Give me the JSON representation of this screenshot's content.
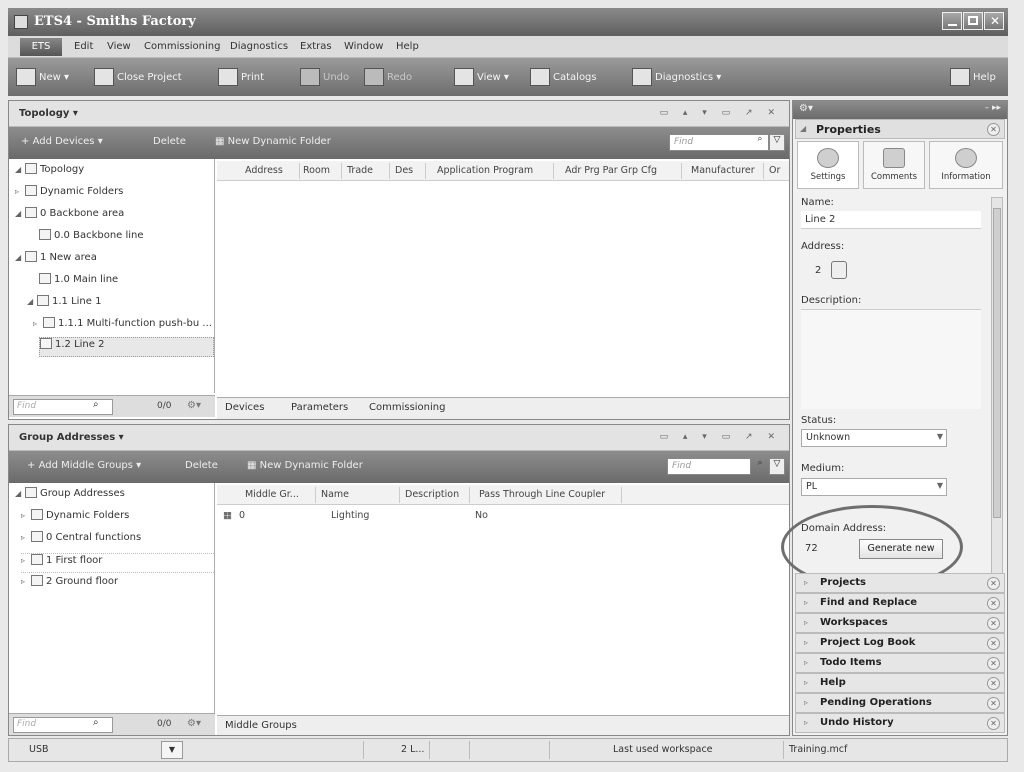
{
  "window": {
    "title": "ETS4 - Smiths Factory"
  },
  "menu": {
    "ets_label": "ETS",
    "items": [
      "Edit",
      "View",
      "Commissioning",
      "Diagnostics",
      "Extras",
      "Window",
      "Help"
    ]
  },
  "toolbar": {
    "new": "New",
    "close_project": "Close Project",
    "print": "Print",
    "undo": "Undo",
    "redo": "Redo",
    "view": "View",
    "catalogs": "Catalogs",
    "diagnostics": "Diagnostics",
    "help": "Help"
  },
  "topology": {
    "title": "Topology",
    "add_devices": "Add Devices",
    "delete": "Delete",
    "new_dynamic_folder": "New Dynamic Folder",
    "find_placeholder": "Find",
    "tree": [
      {
        "label": "Topology"
      },
      {
        "label": "Dynamic Folders"
      },
      {
        "label": "0 Backbone area"
      },
      {
        "label": "0.0 Backbone line"
      },
      {
        "label": "1 New area"
      },
      {
        "label": "1.0 Main line"
      },
      {
        "label": "1.1 Line 1"
      },
      {
        "label": "1.1.1  Multi-function push-bu ..."
      },
      {
        "label": "1.2 Line 2"
      }
    ],
    "columns": [
      "Address",
      "Room",
      "Trade",
      "Des",
      "Application Program",
      "Adr Prg Par Grp Cfg",
      "Manufacturer",
      "Or"
    ],
    "bottom_find": "Find",
    "count": "0/0",
    "tabs": [
      "Devices",
      "Parameters",
      "Commissioning"
    ]
  },
  "group_addresses": {
    "title": "Group Addresses",
    "add_middle_groups": "Add Middle Groups",
    "delete": "Delete",
    "new_dynamic_folder": "New Dynamic Folder",
    "find_placeholder": "Find",
    "tree": [
      {
        "label": "Group Addresses"
      },
      {
        "label": "Dynamic Folders"
      },
      {
        "label": "0 Central functions"
      },
      {
        "label": "1 First floor"
      },
      {
        "label": "2 Ground floor"
      }
    ],
    "columns": [
      "Middle Gr...",
      "Name",
      "Description",
      "Pass Through Line Coupler"
    ],
    "rows": [
      {
        "middle": "0",
        "name": "Lighting",
        "description": "",
        "pass": "No"
      }
    ],
    "bottom_find": "Find",
    "count": "0/0",
    "tabs": [
      "Middle Groups"
    ]
  },
  "properties": {
    "title": "Properties",
    "tabs": [
      "Settings",
      "Comments",
      "Information"
    ],
    "name_label": "Name:",
    "name_value": "Line 2",
    "address_label": "Address:",
    "address_value": "2",
    "description_label": "Description:",
    "status_label": "Status:",
    "status_value": "Unknown",
    "medium_label": "Medium:",
    "medium_value": "PL",
    "domain_label": "Domain Address:",
    "domain_value": "72",
    "generate_btn": "Generate new"
  },
  "accordion": [
    "Projects",
    "Find and Replace",
    "Workspaces",
    "Project Log Book",
    "Todo Items",
    "Help",
    "Pending Operations",
    "Undo History"
  ],
  "status": {
    "interface": "USB",
    "middle": "2 L...",
    "workspace": "Last used workspace",
    "file": "Training.mcf"
  },
  "colors": {
    "toolbar": "#7a7a7a",
    "panel_bg": "#ffffff",
    "highlight": "#6e6e6e"
  }
}
